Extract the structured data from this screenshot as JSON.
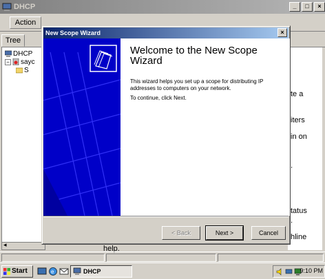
{
  "console": {
    "title": "DHCP",
    "menu_action": "Action",
    "tree_tab": "Tree",
    "tree": {
      "root": "DHCP",
      "server": "sayc",
      "scope": "S"
    },
    "right_pane_fragments": [
      "te a",
      "iters",
      "in on",
      ".",
      "tatus",
      ".",
      "hline"
    ],
    "bottom_help": "help."
  },
  "wizard": {
    "title": "New Scope Wizard",
    "heading": "Welcome to the New Scope Wizard",
    "description": "This wizard helps you set up a scope for distributing IP addresses to computers on your network.",
    "continue_text": "To continue, click Next.",
    "buttons": {
      "back": "< Back",
      "next": "Next >",
      "cancel": "Cancel"
    }
  },
  "taskbar": {
    "start_label": "Start",
    "task_label": "DHCP",
    "clock": "9:10 PM"
  },
  "colors": {
    "banner": "#0000c8",
    "title_active": "#0a246a",
    "title_inactive": "#808080"
  }
}
